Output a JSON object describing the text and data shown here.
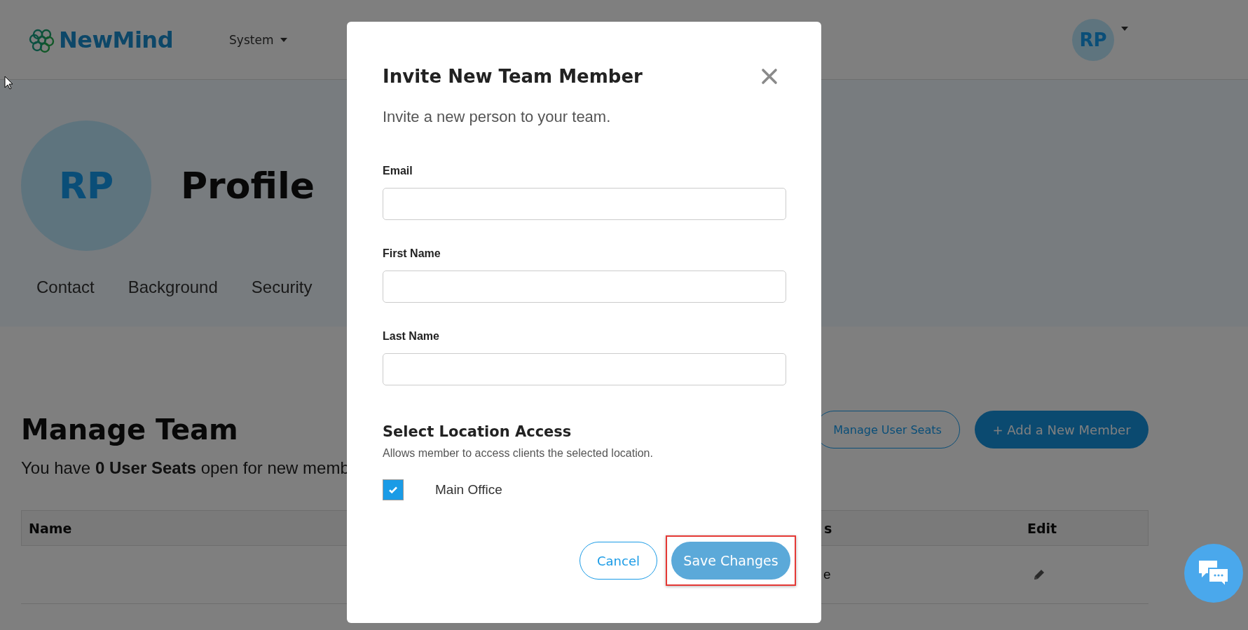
{
  "header": {
    "logo_text": "NewMind",
    "nav": [
      {
        "label": "System"
      }
    ],
    "avatar_initials": "RP"
  },
  "profile": {
    "initials": "RP",
    "title": "Profile",
    "tabs": [
      {
        "label": "Contact",
        "selected": false
      },
      {
        "label": "Background",
        "selected": false
      },
      {
        "label": "Security",
        "selected": false
      }
    ]
  },
  "team": {
    "title": "Manage Team",
    "summary": "You have **0 User Seats** open for new memb",
    "buttons": [
      {
        "label": "Manage User Seats",
        "kind": "outline"
      },
      {
        "label": "+ Add a New Member",
        "kind": "primary"
      }
    ],
    "table": {
      "columns": [
        "Name",
        "s",
        "Edit"
      ],
      "rows": [
        {
          "column_2": "e"
        }
      ]
    }
  },
  "modal": {
    "title": "Invite New Team Member",
    "subtitle": "Invite a new person to your team.",
    "fields": [
      {
        "label": "Email"
      },
      {
        "label": "First Name"
      },
      {
        "label": "Last Name"
      }
    ],
    "section_title": "Select Location Access",
    "section_note": "Allows member to access clients the selected location.",
    "locations": [
      {
        "label": "Main Office",
        "checked": true
      }
    ],
    "buttons": [
      {
        "label": "Cancel",
        "kind": "outline",
        "highlighted": false
      },
      {
        "label": "Save Changes",
        "kind": "primary",
        "highlighted": true
      }
    ]
  }
}
